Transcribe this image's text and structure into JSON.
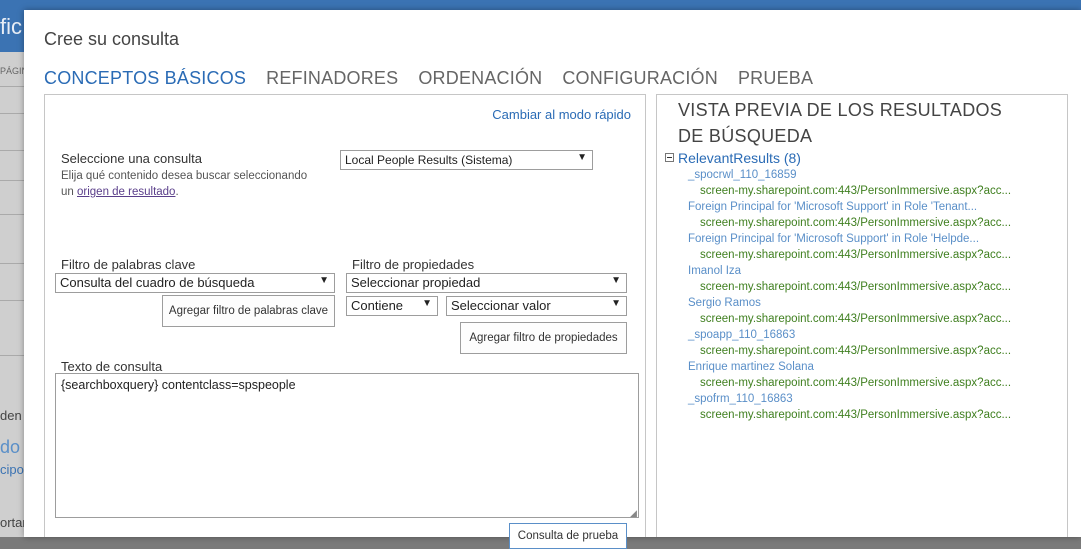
{
  "background": {
    "header_text": "fic",
    "nav_label": "PÁGIN",
    "texts": [
      "den I",
      "do i",
      "cipo",
      "ortan"
    ]
  },
  "dialog": {
    "title": "Cree su consulta",
    "tabs": [
      {
        "label": "CONCEPTOS BÁSICOS",
        "active": true
      },
      {
        "label": "REFINADORES",
        "active": false
      },
      {
        "label": "ORDENACIÓN",
        "active": false
      },
      {
        "label": "CONFIGURACIÓN",
        "active": false
      },
      {
        "label": "PRUEBA",
        "active": false
      }
    ]
  },
  "left": {
    "quick_mode_link": "Cambiar al modo rápido",
    "select_query_label": "Seleccione una consulta",
    "select_query_hint_before": "Elija qué contenido desea buscar seleccionando un ",
    "select_query_hint_link": "origen de resultado",
    "select_query_hint_after": ".",
    "result_source_value": "Local People Results (Sistema)",
    "keyword_filter_label": "Filtro de palabras clave",
    "keyword_filter_value": "Consulta del cuadro de búsqueda",
    "add_keyword_filter_button": "Agregar filtro de palabras clave",
    "property_filter_label": "Filtro de propiedades",
    "property_select_value": "Seleccionar propiedad",
    "operator_value": "Contiene",
    "value_select_value": "Seleccionar valor",
    "add_property_filter_button": "Agregar filtro de propiedades",
    "query_text_label": "Texto de consulta",
    "query_text_value": "{searchboxquery} contentclass=spspeople",
    "test_button": "Consulta de prueba"
  },
  "right": {
    "preview_title": "VISTA PREVIA DE LOS RESULTADOS DE BÚSQUEDA",
    "group_label": "RelevantResults (8)",
    "results": [
      {
        "title": "_spocrwl_110_16859",
        "url": "screen-my.sharepoint.com:443/PersonImmersive.aspx?acc..."
      },
      {
        "title": "Foreign Principal for 'Microsoft Support' in Role 'Tenant...",
        "url": "screen-my.sharepoint.com:443/PersonImmersive.aspx?acc..."
      },
      {
        "title": "Foreign Principal for 'Microsoft Support' in Role 'Helpde...",
        "url": "screen-my.sharepoint.com:443/PersonImmersive.aspx?acc..."
      },
      {
        "title": "Imanol Iza",
        "url": "screen-my.sharepoint.com:443/PersonImmersive.aspx?acc..."
      },
      {
        "title": "Sergio Ramos",
        "url": "screen-my.sharepoint.com:443/PersonImmersive.aspx?acc..."
      },
      {
        "title": "_spoapp_110_16863",
        "url": "screen-my.sharepoint.com:443/PersonImmersive.aspx?acc..."
      },
      {
        "title": "Enrique martinez Solana",
        "url": "screen-my.sharepoint.com:443/PersonImmersive.aspx?acc..."
      },
      {
        "title": "_spofrm_110_16863",
        "url": "screen-my.sharepoint.com:443/PersonImmersive.aspx?acc..."
      }
    ]
  },
  "colors": {
    "accent": "#2a6bb5",
    "header": "#3b73b3",
    "url_green": "#3f7f1f",
    "visited_link": "#5a3e8a"
  },
  "icons": {
    "dropdown": "chevron-down-icon",
    "collapse": "collapse-minus-icon",
    "resize": "resize-grip-icon"
  }
}
